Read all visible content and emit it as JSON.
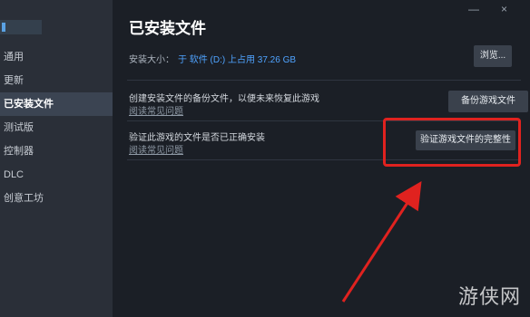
{
  "sidebar": {
    "items": [
      {
        "label": "通用"
      },
      {
        "label": "更新"
      },
      {
        "label": "已安装文件"
      },
      {
        "label": "测试版"
      },
      {
        "label": "控制器"
      },
      {
        "label": "DLC"
      },
      {
        "label": "创意工坊"
      }
    ]
  },
  "window": {
    "minimize_glyph": "—",
    "close_glyph": "×"
  },
  "main": {
    "title": "已安装文件",
    "install_size_label": "安装大小：",
    "install_size_value": "于 软件 (D:) 上占用 37.26 GB",
    "browse_button": "浏览...",
    "backup": {
      "text": "创建安装文件的备份文件，以便未来恢复此游戏",
      "link": "阅读常见问题",
      "button": "备份游戏文件"
    },
    "verify": {
      "text": "验证此游戏的文件是否已正确安装",
      "link": "阅读常见问题",
      "button": "验证游戏文件的完整性"
    }
  },
  "colors": {
    "accent_blue": "#4fa3ff",
    "highlight_red": "#e0221f"
  },
  "watermark": "游侠网"
}
